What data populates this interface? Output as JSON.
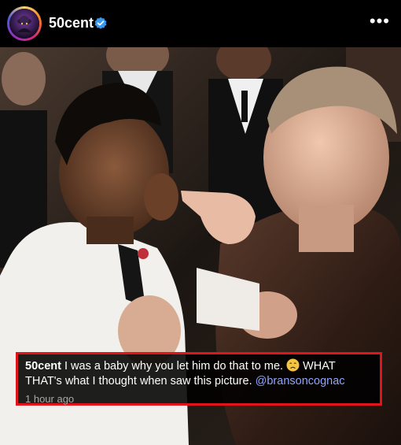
{
  "post": {
    "username": "50cent",
    "verified": true,
    "more_label": "•••"
  },
  "caption": {
    "username": "50cent",
    "line1_text": "I was a baby why you let him do that to me.",
    "line1_after_emoji": "WHAT",
    "line2_text": "THAT's what I thought when saw this picture.",
    "mention": "@bransoncognac",
    "timestamp": "1 hour ago"
  },
  "colors": {
    "highlight_border": "#e0141a",
    "verified": "#3897f0",
    "mention": "#8fa5ff"
  },
  "icons": {
    "verified": "verified-badge-icon",
    "emoji": "disappointed-face-emoji"
  }
}
